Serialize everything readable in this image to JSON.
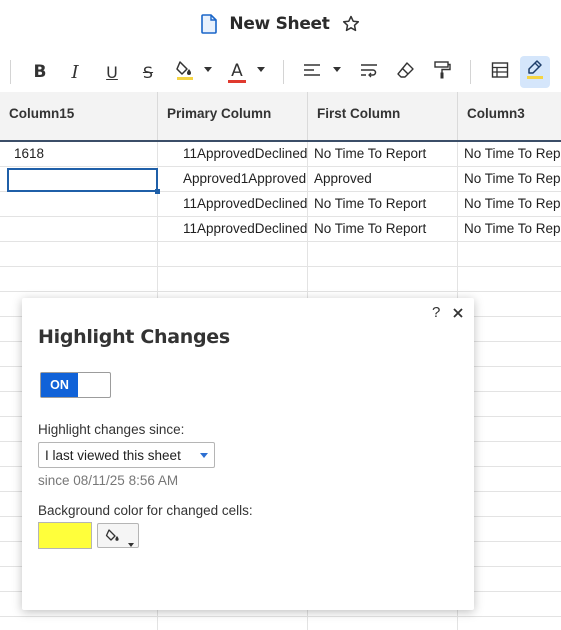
{
  "app": {
    "sheet_title": "New Sheet"
  },
  "toolbar": {
    "icons": [
      "bold-icon",
      "italic-icon",
      "underline-icon",
      "strikethrough-icon",
      "fill-color-icon",
      "text-color-icon",
      "align-icon",
      "wrap-text-icon",
      "clear-format-icon",
      "format-painter-icon",
      "table-icon",
      "highlight-changes-icon"
    ],
    "bold_label": "B",
    "italic_label": "I",
    "underline_label": "U",
    "strike_label": "S",
    "text_color_label": "A",
    "fill_indicator_color": "#f4d443",
    "text_color_indicator": "#e03a2f",
    "highlight_indicator_color": "#f4d443"
  },
  "grid": {
    "columns": [
      "Column15",
      "Primary Column",
      "First Column",
      "Column3"
    ],
    "rows": [
      [
        "1618",
        "11ApprovedDeclined",
        "No Time To Report",
        "No Time To Report"
      ],
      [
        "",
        "Approved1Approved",
        "Approved",
        "No Time To Report"
      ],
      [
        "",
        "11ApprovedDeclined",
        "No Time To Report",
        "No Time To Report"
      ],
      [
        "",
        "11ApprovedDeclined",
        "No Time To Report",
        "No Time To Report"
      ]
    ]
  },
  "dialog": {
    "title": "Highlight Changes",
    "help_label": "?",
    "toggle_label": "ON",
    "since_label": "Highlight changes since:",
    "since_value": "I last viewed this sheet",
    "since_timestamp": "since 08/11/25 8:56 AM",
    "bg_label": "Background color for changed cells:",
    "swatch_color": "#ffff3b"
  }
}
